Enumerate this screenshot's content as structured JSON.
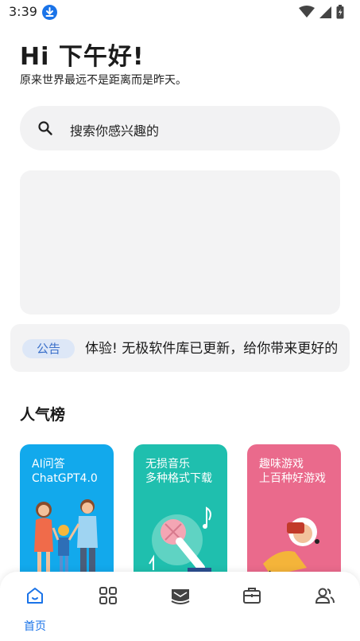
{
  "status_bar": {
    "time": "3:39"
  },
  "header": {
    "greeting": "Hi 下午好!",
    "subtitle": "原来世界最远不是距离而是昨天。"
  },
  "search": {
    "placeholder": "搜索你感兴趣的"
  },
  "notice": {
    "badge": "公告",
    "text": "体验!   无极软件库已更新，给你带来更好的体验!"
  },
  "section": {
    "title": "人气榜"
  },
  "cards": [
    {
      "line1": "AI问答",
      "line2": "ChatGPT4.0",
      "color": "#12a9ec"
    },
    {
      "line1": "无损音乐",
      "line2": "多种格式下载",
      "color": "#1fbfae"
    },
    {
      "line1": "趣味游戏",
      "line2": "上百种好游戏",
      "color": "#ea6a8c"
    }
  ],
  "bottom_nav": {
    "items": [
      {
        "label": "首页",
        "icon": "home-icon",
        "active": true
      },
      {
        "label": "",
        "icon": "grid-icon",
        "active": false
      },
      {
        "label": "",
        "icon": "inbox-icon",
        "active": false
      },
      {
        "label": "",
        "icon": "briefcase-icon",
        "active": false
      },
      {
        "label": "",
        "icon": "users-icon",
        "active": false
      }
    ],
    "active_color": "#1a73e8",
    "inactive_color": "#444444"
  }
}
